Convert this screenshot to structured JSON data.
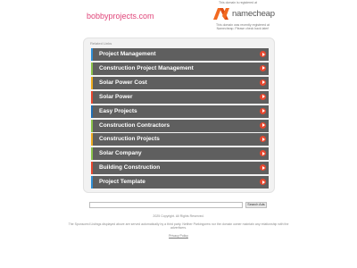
{
  "header": {
    "domain": "bobbyprojects.com",
    "registrar_note_top": "This domain is registered at",
    "registrar_name": "namecheap",
    "registrar_note_bottom": "This domain was recently registered at Namecheap. Please check back later!"
  },
  "related_links": {
    "heading": "Related Links",
    "items": [
      {
        "label": "Project Management",
        "color": "#2f8fd6"
      },
      {
        "label": "Construction Project Management",
        "color": "#8bc34a"
      },
      {
        "label": "Solar Power Cost",
        "color": "#f0ad1f"
      },
      {
        "label": "Solar Power",
        "color": "#e8472f"
      },
      {
        "label": "Easy Projects",
        "color": "#1f6fb5"
      },
      {
        "label": "Construction Contractors",
        "color": "#8bc34a"
      },
      {
        "label": "Construction Projects",
        "color": "#f0ad1f"
      },
      {
        "label": "Solar Company",
        "color": "#8bc34a"
      },
      {
        "label": "Building Construction",
        "color": "#e8472f"
      },
      {
        "label": "Project Template",
        "color": "#2f8fd6"
      }
    ]
  },
  "search": {
    "placeholder": "",
    "button_label": "Search Ads"
  },
  "footer": {
    "copyright": "2025 Copyright. All Rights Reserved.",
    "disclaimer": "The Sponsored Listings displayed above are served automatically by a third party. Neither Parkingcrew nor the domain owner maintain any relationship with the advertisers.",
    "privacy_label": "Privacy Policy"
  }
}
